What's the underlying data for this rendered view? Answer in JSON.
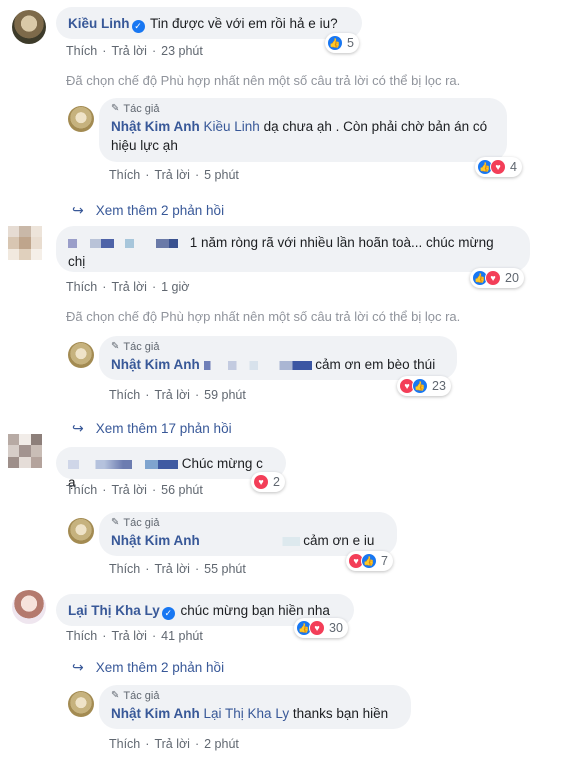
{
  "labels": {
    "like": "Thích",
    "reply": "Trả lời",
    "author_badge": "Tác giả",
    "filter_note": "Đã chọn chế độ Phù hợp nhất nên một số câu trả lời có thể bị lọc ra."
  },
  "c1": {
    "name": "Kiều Linh",
    "text": "Tin được về với em rồi hả e iu?",
    "time": "23 phút",
    "reactions": "5"
  },
  "r1": {
    "name": "Nhật Kim Anh",
    "mention": "Kiều Linh",
    "text_line1": "dạ chưa ạh . Còn phải chờ bản án có",
    "text_line2": "hiệu lực ạh",
    "time": "5 phút",
    "reactions": "4"
  },
  "more1": "Xem thêm 2 phản hồi",
  "c2": {
    "text_line1": "1 năm ròng rã với nhiều lần hoãn toà... chúc mừng",
    "text_line2": "chị",
    "time": "1 giờ",
    "reactions": "20"
  },
  "r2": {
    "name": "Nhật Kim Anh",
    "text": "cảm ơn em bèo thúi",
    "time": "59 phút",
    "reactions": "23"
  },
  "more2": "Xem thêm 17 phản hồi",
  "c3": {
    "text": "Chúc mừng c ạ",
    "time": "56 phút",
    "reactions": "2"
  },
  "r3": {
    "name": "Nhật Kim Anh",
    "text": "cảm ơn e iu",
    "time": "55 phút",
    "reactions": "7"
  },
  "c4": {
    "name": "Lại Thị Kha Ly",
    "text": "chúc mừng bạn hiền nha",
    "time": "41 phút",
    "reactions": "30"
  },
  "more3": "Xem thêm 2 phản hồi",
  "r4": {
    "name": "Nhật Kim Anh",
    "mention": "Lại Thị Kha Ly",
    "text": "thanks bạn hiền",
    "time": "2 phút"
  },
  "icons": {
    "verified": "verified-check-icon",
    "like": "like-thumb-icon",
    "love": "love-heart-icon",
    "reply_arrow": "reply-arrow-icon",
    "pen": "pencil-icon"
  },
  "colors": {
    "link": "#385898",
    "bubble": "#f0f2f5",
    "meta": "#606770",
    "like": "#1877f2",
    "love": "#f33e58"
  }
}
